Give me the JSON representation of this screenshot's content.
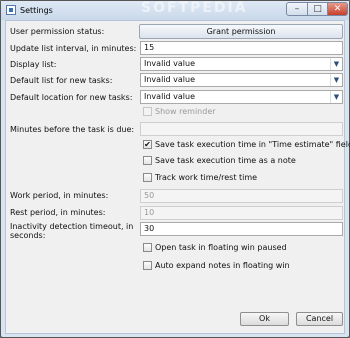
{
  "window": {
    "title": "Settings",
    "watermark": "SOFTPEDIA",
    "minimize": "–",
    "maximize": "□",
    "close": "✕"
  },
  "labels": {
    "user_permission": "User permission status:",
    "update_interval": "Update list interval, in minutes:",
    "display_list": "Display list:",
    "default_list": "Default list for new tasks:",
    "default_location": "Default location for new tasks:",
    "minutes_before_due": "Minutes before the task is due:",
    "work_period": "Work period, in minutes:",
    "rest_period": "Rest period, in minutes:",
    "inactivity_line1": "Inactivity detection timeout, in",
    "inactivity_line2": "seconds:"
  },
  "buttons": {
    "grant": "Grant permission",
    "ok": "Ok",
    "cancel": "Cancel"
  },
  "fields": {
    "update_interval": "15",
    "display_list": "Invalid value",
    "default_list": "Invalid value",
    "default_location": "Invalid value",
    "minutes_before_due": "",
    "work_period": "50",
    "rest_period": "10",
    "inactivity": "30"
  },
  "checkboxes": {
    "show_reminder": {
      "label": "Show reminder",
      "checked": false,
      "disabled": true
    },
    "save_time_estimate": {
      "label": "Save task execution time in \"Time estimate\" field",
      "checked": true
    },
    "save_time_note": {
      "label": "Save task execution time as a note",
      "checked": false
    },
    "track_work_rest": {
      "label": "Track work time/rest time",
      "checked": false
    },
    "open_floating_paused": {
      "label": "Open task in floating win paused",
      "checked": false
    },
    "auto_expand_notes": {
      "label": "Auto expand notes in floating win",
      "checked": false
    }
  },
  "check_glyph": "✔",
  "dropdown_icon": "chevron-down-icon"
}
